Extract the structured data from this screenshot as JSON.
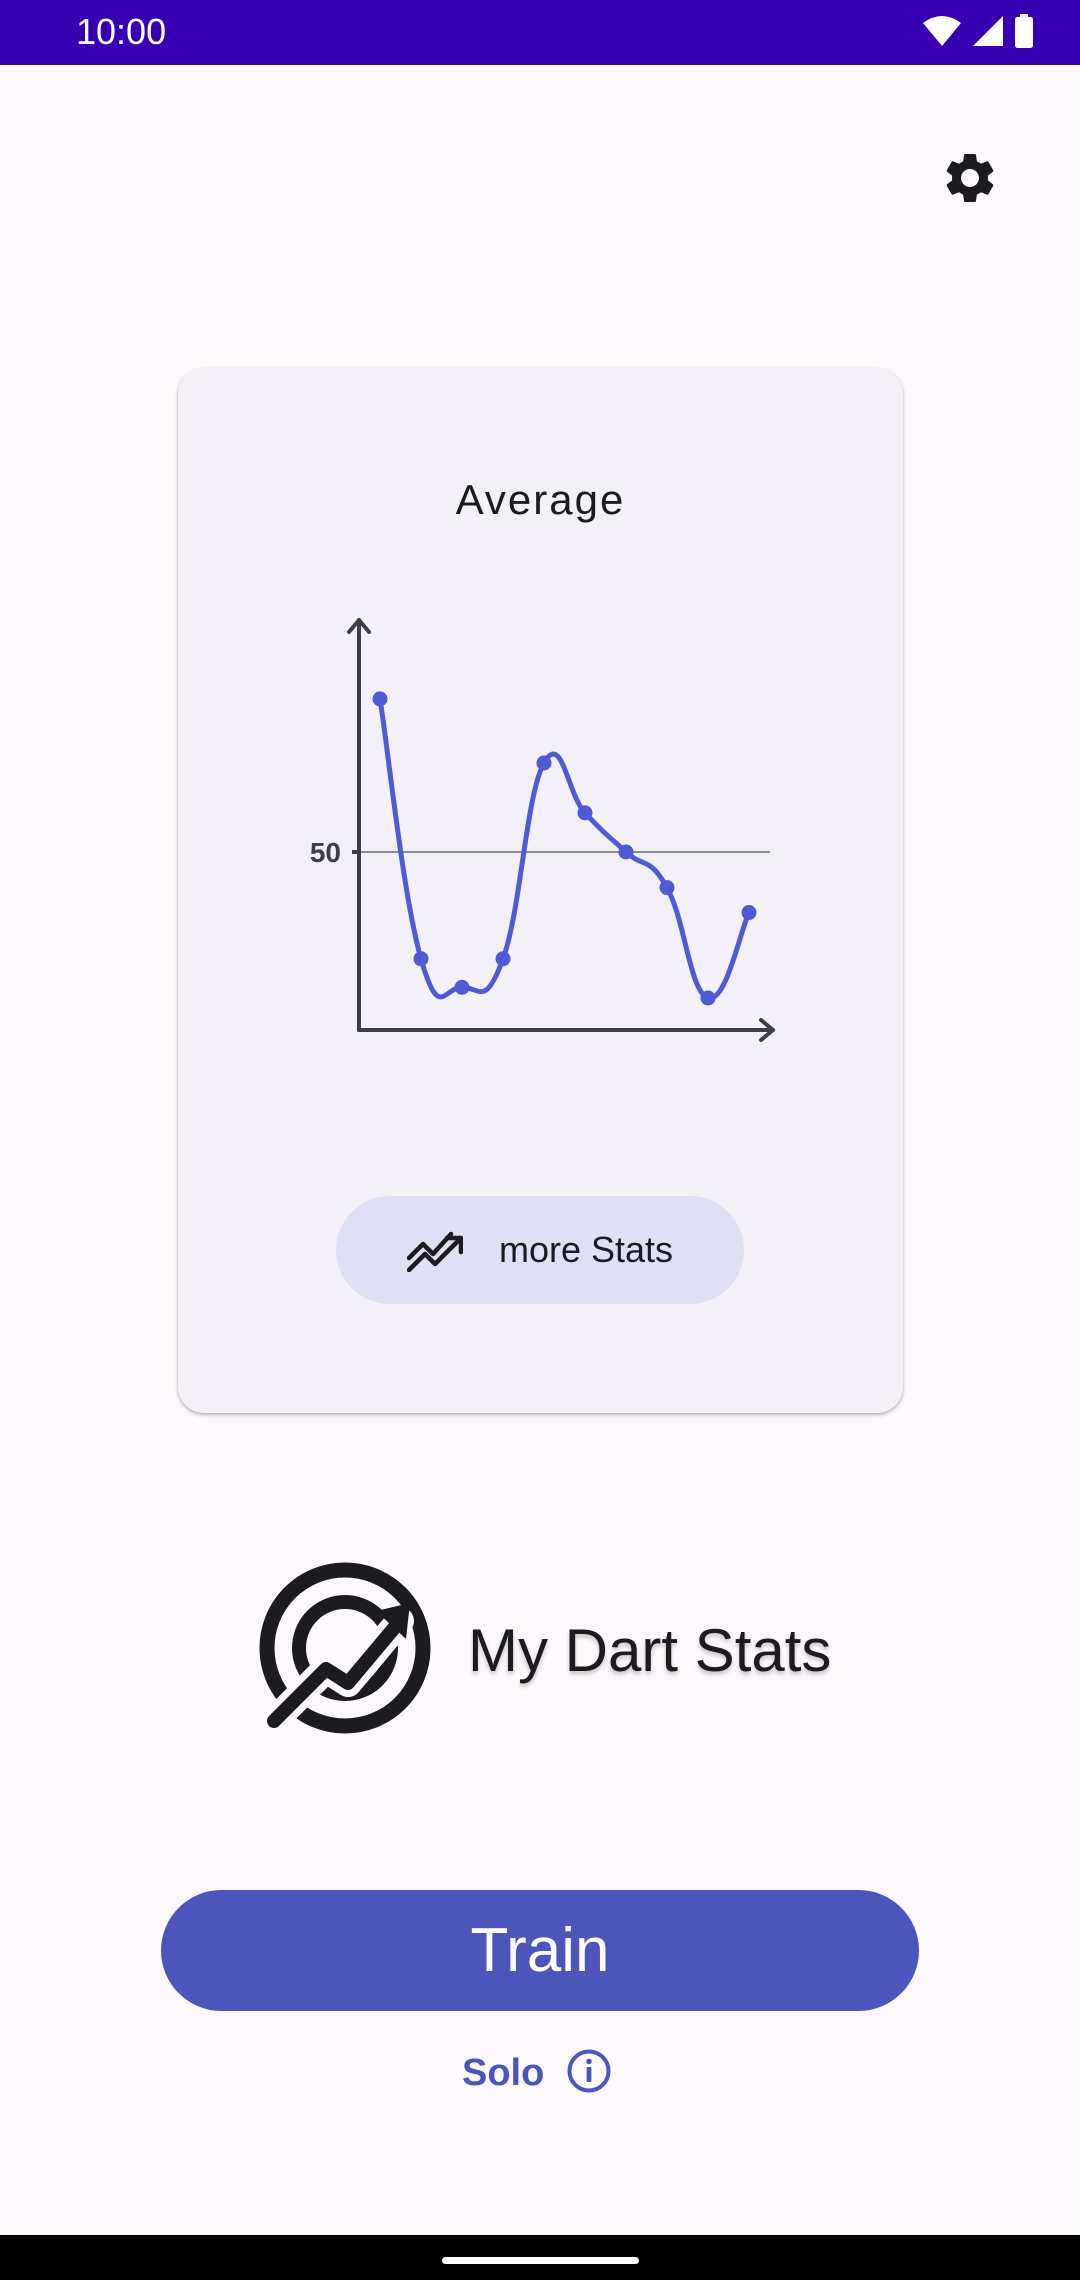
{
  "status_bar": {
    "time": "10:00",
    "icons": [
      "wifi-icon",
      "signal-icon",
      "battery-icon"
    ]
  },
  "settings": {
    "icon": "gear-icon"
  },
  "stats_card": {
    "title": "Average",
    "more_stats_label": "more Stats",
    "more_stats_icon": "trending-up-icon"
  },
  "chart_data": {
    "type": "line",
    "title": "Average",
    "y_tick_labels": [
      "50"
    ],
    "reference_line": 50,
    "x": [
      1,
      2,
      3,
      4,
      5,
      6,
      7,
      8,
      9,
      10
    ],
    "values": [
      93,
      20,
      12,
      20,
      75,
      61,
      50,
      40,
      9,
      33
    ],
    "smoothed": true,
    "axes_arrows": true,
    "series_color": "#4f5bd5"
  },
  "app": {
    "name": "My Dart Stats",
    "logo_icon": "dart-target-trending-icon"
  },
  "actions": {
    "train_label": "Train",
    "mode_label": "Solo",
    "info_icon": "info-icon"
  },
  "colors": {
    "status_bar": "#3700b3",
    "primary": "#4b55bb",
    "card_bg": "#f3f0f8",
    "chip_bg": "#e0e0f5",
    "background": "#fdf8fb"
  }
}
